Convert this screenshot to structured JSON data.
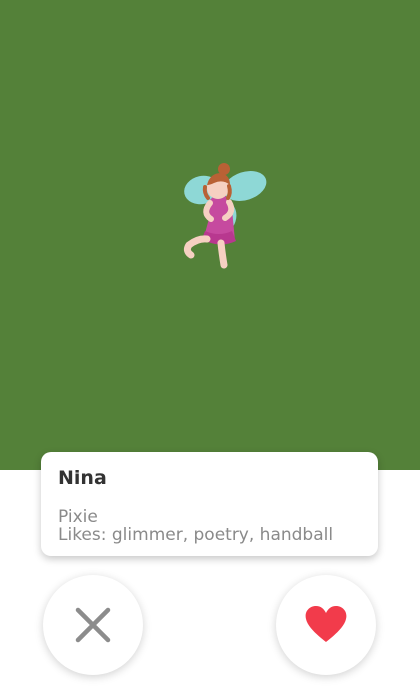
{
  "profile": {
    "name": "Nina",
    "species": "Pixie",
    "likes_prefix": "Likes: ",
    "likes": [
      "glimmer",
      "poetry",
      "handball"
    ],
    "likes_text": "glimmer, poetry, handball",
    "background_color": "#548139",
    "avatar_icon": "fairy-icon"
  },
  "actions": {
    "dislike_icon": "close-icon",
    "like_icon": "heart-icon",
    "dislike_color": "#8c8c8c",
    "like_color": "#f23b4b"
  }
}
